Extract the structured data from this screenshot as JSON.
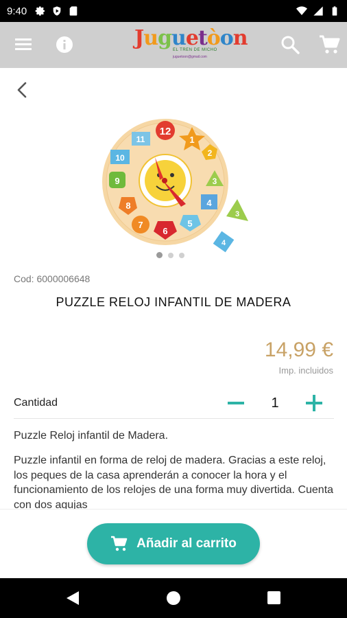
{
  "status_bar": {
    "time": "9:40",
    "icons_left": [
      "settings-icon",
      "play-shield-icon",
      "sd-card-icon"
    ],
    "icons_right": [
      "wifi-icon",
      "signal-icon",
      "battery-icon"
    ]
  },
  "app_bar": {
    "background": "#cfcfcf",
    "menu_icon": "menu-icon",
    "info_icon": "info-icon",
    "logo_text": "Juguetòon",
    "logo_sub1": "EL TREN DE MICHO",
    "logo_sub2": "juguetoon@gmail.com",
    "search_icon": "search-icon",
    "cart_icon": "cart-icon"
  },
  "product": {
    "code_label": "Cod: 6000006648",
    "title": "PUZZLE RELOJ INFANTIL DE MADERA",
    "price": "14,99 €",
    "price_color": "#c8a266",
    "tax_note": "Imp. incluidos",
    "image_count": 3,
    "active_image": 1
  },
  "quantity": {
    "label": "Cantidad",
    "value": "1",
    "accent": "#2db3a6"
  },
  "description": {
    "short": "Puzzle Reloj infantil de Madera.",
    "long": "Puzzle infantil en forma de reloj de madera. Gracias a este reloj, los peques de la casa aprenderán a conocer la hora y el funcionamiento de los relojes de una forma muy divertida. Cuenta con dos agujas"
  },
  "cta": {
    "label": "Añadir al carrito",
    "color": "#2db3a6"
  }
}
